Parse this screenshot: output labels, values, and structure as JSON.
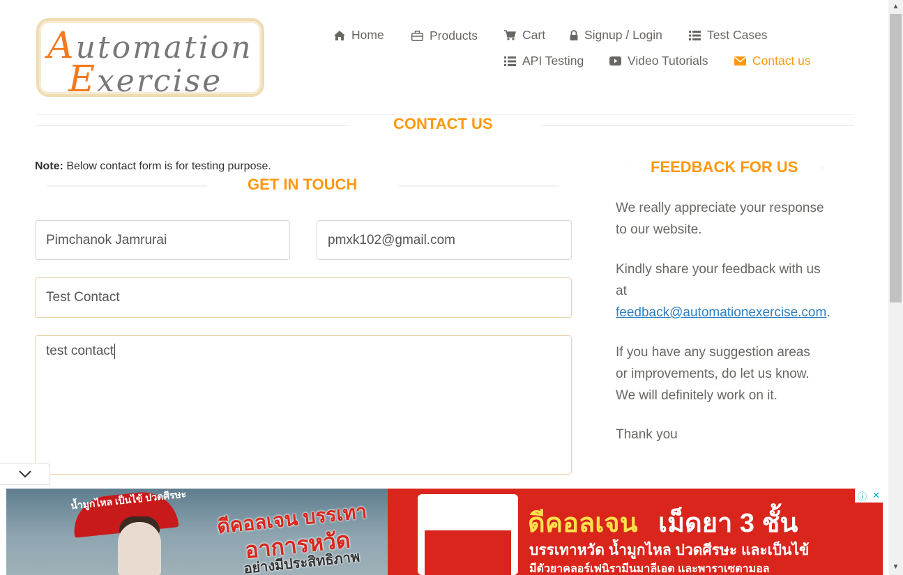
{
  "logo": {
    "line1_cap": "A",
    "line1_rest": "utomation",
    "line2_cap": "E",
    "line2_rest": "xercise"
  },
  "nav": {
    "items": [
      {
        "label": "Home",
        "icon": "home-icon"
      },
      {
        "label": "Products",
        "icon": "briefcase-icon"
      },
      {
        "label": "Cart",
        "icon": "cart-icon"
      },
      {
        "label": "Signup / Login",
        "icon": "lock-icon"
      },
      {
        "label": "Test Cases",
        "icon": "list-icon"
      },
      {
        "label": "API Testing",
        "icon": "list-icon"
      },
      {
        "label": "Video Tutorials",
        "icon": "youtube-icon"
      },
      {
        "label": "Contact us",
        "icon": "envelope-icon"
      }
    ],
    "active": "Contact us",
    "active_color": "#fe980f"
  },
  "page": {
    "title": "CONTACT US",
    "note_label": "Note:",
    "note_text": " Below contact form is for testing purpose."
  },
  "form": {
    "title": "GET IN TOUCH",
    "name_value": "Pimchanok Jamrurai",
    "email_value": "pmxk102@gmail.com",
    "subject_value": "Test Contact",
    "message_value": "test contact"
  },
  "feedback": {
    "title": "FEEDBACK FOR US",
    "p1_line1": "We really appreciate your response",
    "p1_line2": "to our website.",
    "p2_line1": "Kindly share your feedback with us",
    "p2_line2": "at",
    "email": "feedback@automationexercise.com",
    "email_suffix": ".",
    "p3_line1": "If you have any suggestion areas",
    "p3_line2": "or improvements, do let us know.",
    "p3_line3": "We will definitely work on it.",
    "p4": "Thank you"
  },
  "ad": {
    "left_tagline": "น้ำมูกไหล เป็นไข้ ปวดศีรษะ",
    "left_brand": "ดีคอลเจน บรรเทา",
    "left_line2": "อาการหวัด",
    "left_line3": "อย่างมีประสิทธิภาพ",
    "box_brand": "ดีคอลเจน",
    "right_brand": "ดีคอลเจน",
    "right_headline": "เม็ดยา 3 ชั้น",
    "right_line2": "บรรเทาหวัด น้ำมูกไหล ปวดศีรษะ และเป็นไข้",
    "right_line3": "มีตัวยาคลอร์เฟนิรามีนมาลีเอต และพาราเซตามอล",
    "info_icon": "info-icon",
    "close_icon": "close-icon"
  },
  "colors": {
    "accent": "#fe980f",
    "text": "#696763",
    "link": "#2e7fc2",
    "ad_red": "#d9251c"
  }
}
